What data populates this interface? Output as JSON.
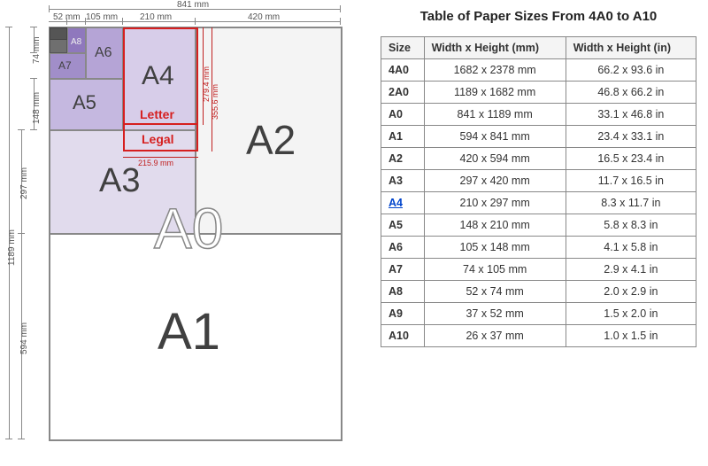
{
  "title": "Table of Paper Sizes From 4A0 to A10",
  "headers": {
    "size": "Size",
    "mm": "Width x Height (mm)",
    "in": "Width x Height (in)"
  },
  "rows": [
    {
      "size": "4A0",
      "mm": "1682 x 2378 mm",
      "in": "66.2 x 93.6 in"
    },
    {
      "size": "2A0",
      "mm": "1189 x 1682 mm",
      "in": "46.8 x 66.2 in"
    },
    {
      "size": "A0",
      "mm": "841 x 1189 mm",
      "in": "33.1 x 46.8 in"
    },
    {
      "size": "A1",
      "mm": "594 x 841 mm",
      "in": "23.4 x 33.1 in"
    },
    {
      "size": "A2",
      "mm": "420 x 594 mm",
      "in": "16.5 x 23.4 in"
    },
    {
      "size": "A3",
      "mm": "297 x 420 mm",
      "in": "11.7 x 16.5 in"
    },
    {
      "size": "A4",
      "mm": "210 x 297 mm",
      "in": "8.3 x 11.7 in",
      "link": true
    },
    {
      "size": "A5",
      "mm": "148 x 210 mm",
      "in": "5.8 x 8.3 in"
    },
    {
      "size": "A6",
      "mm": "105 x 148 mm",
      "in": "4.1 x 5.8 in"
    },
    {
      "size": "A7",
      "mm": "74 x 105 mm",
      "in": "2.9 x 4.1 in"
    },
    {
      "size": "A8",
      "mm": "52 x 74 mm",
      "in": "2.0 x 2.9 in"
    },
    {
      "size": "A9",
      "mm": "37 x 52 mm",
      "in": "1.5 x 2.0 in"
    },
    {
      "size": "A10",
      "mm": "26 x 37 mm",
      "in": "1.0 x 1.5 in"
    }
  ],
  "diagram": {
    "labels": {
      "a0": "A0",
      "a1": "A1",
      "a2": "A2",
      "a3": "A3",
      "a4": "A4",
      "a5": "A5",
      "a6": "A6",
      "a7": "A7",
      "a8": "A8",
      "letter": "Letter",
      "legal": "Legal"
    },
    "dims": {
      "w841": "841 mm",
      "w420": "420 mm",
      "w210": "210 mm",
      "w105": "105 mm",
      "w52": "52 mm",
      "h1189": "1189 mm",
      "h594": "594 mm",
      "h297": "297 mm",
      "h148": "148 mm",
      "h74": "74 mm",
      "letter_w": "215.9 mm",
      "letter_h": "279.4 mm",
      "legal_h": "355.6 mm"
    }
  }
}
